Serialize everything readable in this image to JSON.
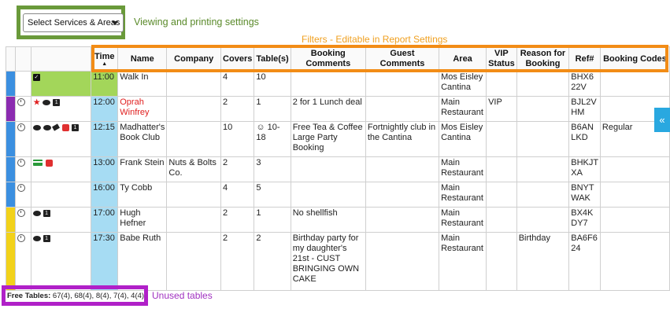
{
  "toolbar": {
    "select_label": "Select Services & Areas"
  },
  "annotations": {
    "viewing_settings": "Viewing and printing settings",
    "filters_note": "Filters - Editable in Report Settings",
    "unused_tables": "Unused tables"
  },
  "columns": [
    "Time",
    "Name",
    "Company",
    "Covers",
    "Table(s)",
    "Booking Comments",
    "Guest Comments",
    "Area",
    "VIP Status",
    "Reason for Booking",
    "Ref#",
    "Booking Codes"
  ],
  "sort_indicator": "▲",
  "colors": {
    "blue": "#3b8fe0",
    "purple": "#8b2bb0",
    "yellow": "#f2d21a",
    "time_bg": "#a6dcf3",
    "time_bg_seated": "#a3d65a",
    "accent_orange": "#f28c16",
    "accent_green": "#6a9a3a",
    "accent_purple": "#b020c8"
  },
  "rows": [
    {
      "bar": "blue",
      "icons": [
        "checkbox-icon"
      ],
      "seated": true,
      "time": "11:00",
      "name": "Walk In",
      "company": "",
      "covers": "4",
      "tables": "10",
      "booking_comments": "",
      "guest_comments": "",
      "area": "Mos Eisley Cantina",
      "vip": "",
      "reason": "",
      "ref": "BHX6 22V",
      "codes": ""
    },
    {
      "bar": "purple",
      "icons": [
        "clock-icon",
        "star-icon",
        "comment-icon",
        "note-icon"
      ],
      "seated": false,
      "time": "12:00",
      "name": "Oprah Winfrey",
      "company": "",
      "covers": "2",
      "tables": "1",
      "booking_comments": "2 for 1 Lunch deal",
      "guest_comments": "",
      "area": "Main Restaurant",
      "vip": "VIP",
      "reason": "",
      "ref": "BJL2V HM",
      "codes": ""
    },
    {
      "bar": "blue",
      "icons": [
        "clock-icon",
        "chat-icon",
        "comment-icon",
        "tag-icon",
        "ticket-icon",
        "note-icon"
      ],
      "seated": false,
      "time": "12:15",
      "name": "Madhatter's Book Club",
      "company": "",
      "covers": "10",
      "tables": "☺ 10-18",
      "booking_comments": "Free Tea & Coffee Large Party Booking",
      "guest_comments": "Fortnightly club in the Cantina",
      "area": "Mos Eisley Cantina",
      "vip": "",
      "reason": "",
      "ref": "B6AN LKD",
      "codes": "Regular"
    },
    {
      "bar": "blue",
      "icons": [
        "clock-icon",
        "credit-card-icon",
        "allergy-icon"
      ],
      "seated": false,
      "time": "13:00",
      "name": "Frank Stein",
      "company": "Nuts & Bolts Co.",
      "covers": "2",
      "tables": "3",
      "booking_comments": "",
      "guest_comments": "",
      "area": "Main Restaurant",
      "vip": "",
      "reason": "",
      "ref": "BHKJT XA",
      "codes": ""
    },
    {
      "bar": "blue",
      "icons": [
        "clock-icon"
      ],
      "seated": false,
      "time": "16:00",
      "name": "Ty Cobb",
      "company": "",
      "covers": "4",
      "tables": "5",
      "booking_comments": "",
      "guest_comments": "",
      "area": "Main Restaurant",
      "vip": "",
      "reason": "",
      "ref": "BNYT WAK",
      "codes": ""
    },
    {
      "bar": "yellow",
      "icons": [
        "clock-icon",
        "comment-icon",
        "note-icon"
      ],
      "seated": false,
      "time": "17:00",
      "name": "Hugh Hefner",
      "company": "",
      "covers": "2",
      "tables": "1",
      "booking_comments": "No shellfish",
      "guest_comments": "",
      "area": "Main Restaurant",
      "vip": "",
      "reason": "",
      "ref": "BX4K DY7",
      "codes": ""
    },
    {
      "bar": "yellow",
      "icons": [
        "clock-icon",
        "comment-icon",
        "note-icon"
      ],
      "seated": false,
      "time": "17:30",
      "name": "Babe Ruth",
      "company": "",
      "covers": "2",
      "tables": "2",
      "booking_comments": "Birthday party for my daughter's 21st - CUST BRINGING OWN CAKE",
      "guest_comments": "",
      "area": "Main Restaurant",
      "vip": "",
      "reason": "Birthday",
      "ref": "BA6F6 24",
      "codes": ""
    }
  ],
  "footer": {
    "free_tables_label": "Free Tables:",
    "free_tables_value": "67(4), 68(4), 8(4), 7(4), 4(4)"
  },
  "side_tab": {
    "icon": "«"
  }
}
